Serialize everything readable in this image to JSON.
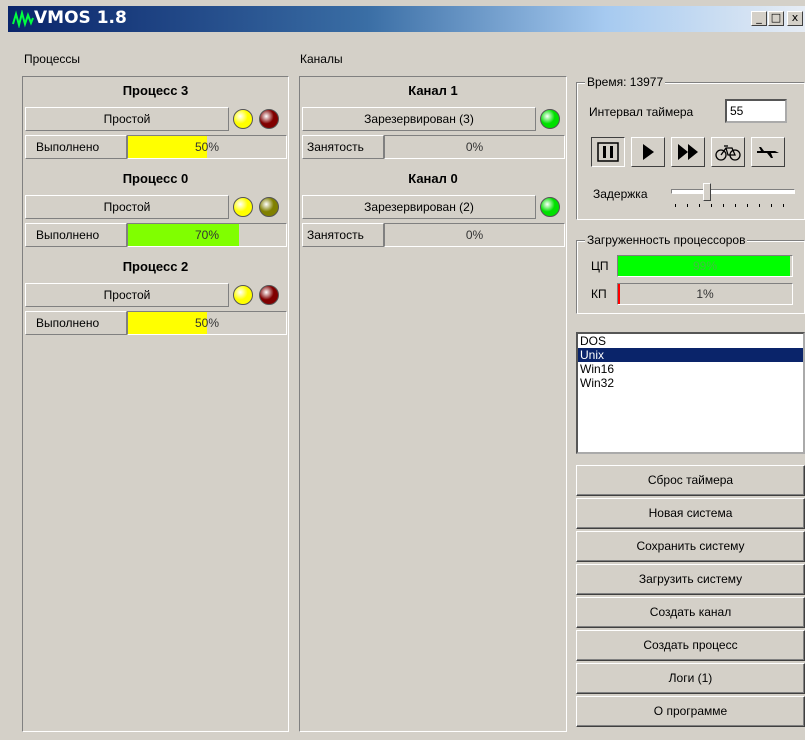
{
  "window": {
    "title": "VMOS 1.8",
    "minimize": "_",
    "maximize": "□",
    "close": "x"
  },
  "processes": {
    "label": "Процессы",
    "items": [
      {
        "name": "Процесс 3",
        "state": "Простой",
        "progress_label": "Выполнено",
        "progress": 50,
        "progress_text": "50%",
        "bar_color": "#ffff00",
        "led1": "#ffff00",
        "led2": "#800000"
      },
      {
        "name": "Процесс 0",
        "state": "Простой",
        "progress_label": "Выполнено",
        "progress": 70,
        "progress_text": "70%",
        "bar_color": "#80ff00",
        "led1": "#ffff00",
        "led2": "#808000"
      },
      {
        "name": "Процесс 2",
        "state": "Простой",
        "progress_label": "Выполнено",
        "progress": 50,
        "progress_text": "50%",
        "bar_color": "#ffff00",
        "led1": "#ffff00",
        "led2": "#800000"
      }
    ]
  },
  "channels": {
    "label": "Каналы",
    "items": [
      {
        "name": "Канал 1",
        "state": "Зарезервирован (3)",
        "busy_label": "Занятость",
        "busy": 0,
        "busy_text": "0%",
        "led": "#00e000"
      },
      {
        "name": "Канал 0",
        "state": "Зарезервирован (2)",
        "busy_label": "Занятость",
        "busy": 0,
        "busy_text": "0%",
        "led": "#00e000"
      }
    ]
  },
  "timer": {
    "time_label": "Время: 13977",
    "interval_label": "Интервал таймера",
    "interval_value": "55",
    "buttons": [
      {
        "icon": "pause-icon",
        "pressed": true
      },
      {
        "icon": "play-icon",
        "pressed": false
      },
      {
        "icon": "fast-forward-icon",
        "pressed": false
      },
      {
        "icon": "bicycle-icon",
        "pressed": false
      },
      {
        "icon": "airplane-icon",
        "pressed": false
      }
    ],
    "delay_label": "Задержка",
    "delay_level": 0.28
  },
  "load": {
    "title": "Загруженность процессоров",
    "cpu_label": "ЦП",
    "cpu_value": 99,
    "cpu_text": "99%",
    "cpu_color": "#00ff00",
    "kp_label": "КП",
    "kp_value": 1,
    "kp_text": "1%",
    "kp_color": "#ff0000"
  },
  "os_list": {
    "items": [
      "DOS",
      "Unix",
      "Win16",
      "Win32"
    ],
    "selected": 1
  },
  "commands": [
    "Сброс таймера",
    "Новая система",
    "Сохранить систему",
    "Загрузить систему",
    "Создать канал",
    "Создать процесс",
    "Логи (1)",
    "О программе"
  ]
}
